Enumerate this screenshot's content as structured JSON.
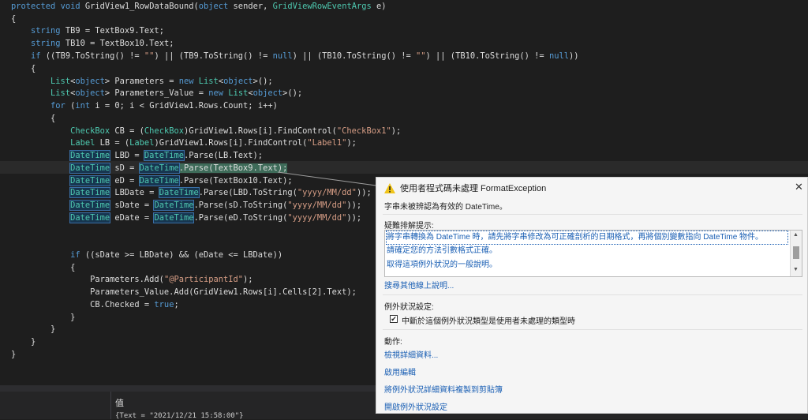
{
  "code": {
    "lines": [
      "protected void GridView1_RowDataBound(object sender, GridViewRowEventArgs e)",
      "{",
      "    string TB9 = TextBox9.Text;",
      "    string TB10 = TextBox10.Text;",
      "    if ((TB9.ToString() != \"\") || (TB9.ToString() != null) || (TB10.ToString() != \"\") || (TB10.ToString() != null))",
      "    {",
      "        List<object> Parameters = new List<object>();",
      "        List<object> Parameters_Value = new List<object>();",
      "        for (int i = 0; i < GridView1.Rows.Count; i++)",
      "        {",
      "            CheckBox CB = (CheckBox)GridView1.Rows[i].FindControl(\"CheckBox1\");",
      "            Label LB = (Label)GridView1.Rows[i].FindControl(\"Label1\");",
      "            DateTime LBD = DateTime.Parse(LB.Text);",
      "            DateTime sD = DateTime.Parse(TextBox9.Text);",
      "            DateTime eD = DateTime.Parse(TextBox10.Text);",
      "            DateTime LBDate = DateTime.Parse(LBD.ToString(\"yyyy/MM/dd\"));",
      "            DateTime sDate = DateTime.Parse(sD.ToString(\"yyyy/MM/dd\"));",
      "            DateTime eDate = DateTime.Parse(eD.ToString(\"yyyy/MM/dd\"));",
      "",
      "",
      "            if ((sDate >= LBDate) && (eDate <= LBDate))",
      "            {",
      "                Parameters.Add(\"@ParticipantId\");",
      "                Parameters_Value.Add(GridView1.Rows[i].Cells[2].Text);",
      "                CB.Checked = true;",
      "            }",
      "        }",
      "    }",
      "}"
    ]
  },
  "exception": {
    "title": "使用者程式碼未處理 FormatException",
    "message": "字串未被辨認為有效的 DateTime。",
    "tips_header": "疑難排解提示:",
    "tips": [
      "將字串轉換為 DateTime 時，請先將字串修改為可正確剖析的日期格式，再將個別變數指向 DateTime 物件。",
      "請確定您的方法引數格式正確。",
      "取得這項例外狀況的一般說明。"
    ],
    "search_link": "搜尋其他線上說明...",
    "settings_header": "例外狀況設定:",
    "break_checkbox_label": "中斷於這個例外狀況類型是使用者未處理的類型時",
    "break_checked": true,
    "actions_header": "動作:",
    "actions": [
      "檢視詳細資料...",
      "啟用編輯",
      "將例外狀況詳細資料複製到剪貼簿",
      "開啟例外狀況設定"
    ]
  },
  "watch": {
    "column_header": "值",
    "value": "{Text = \"2021/12/21 15:58:00\"}"
  }
}
